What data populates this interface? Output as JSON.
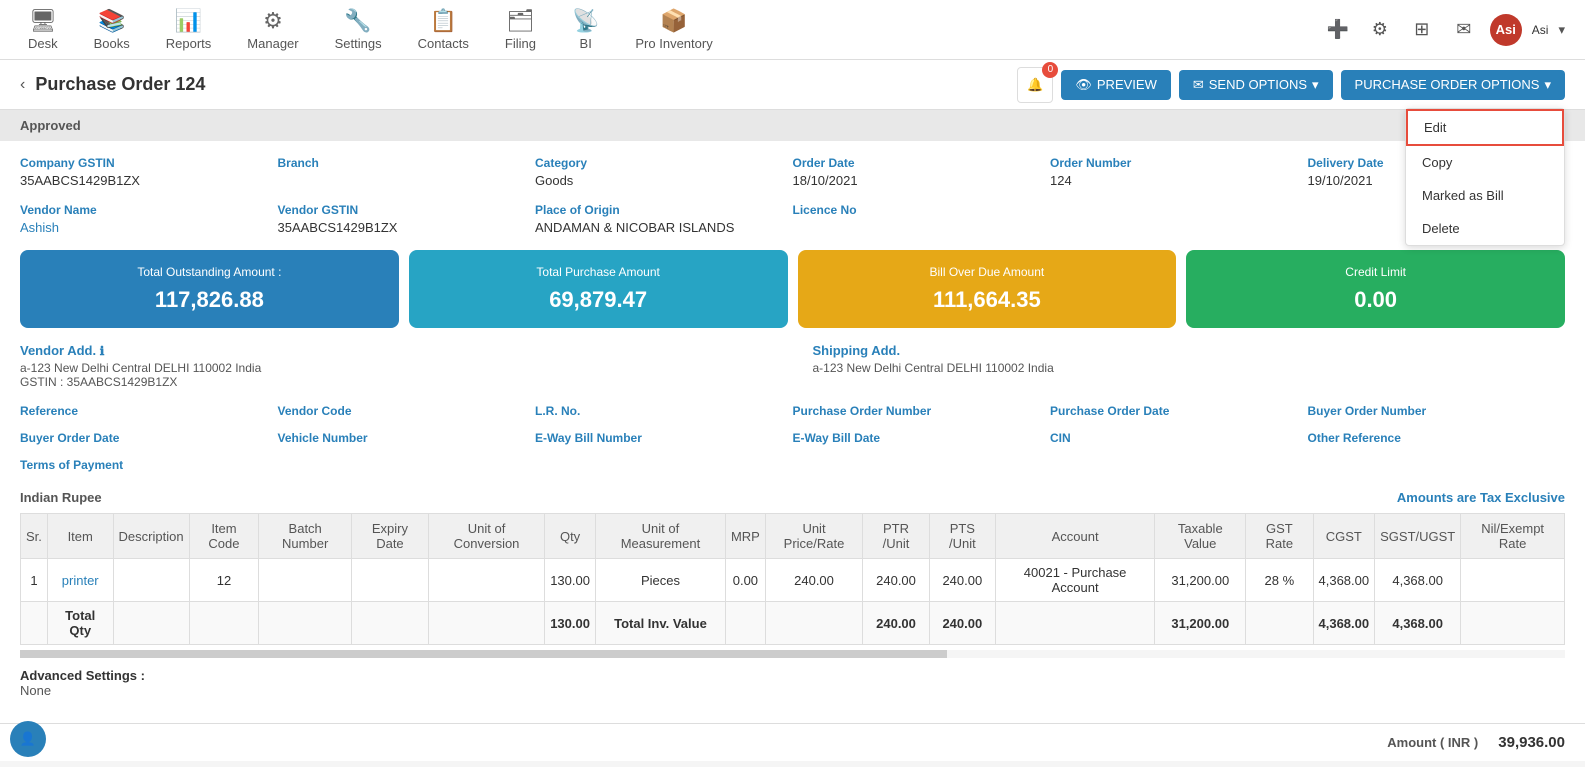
{
  "nav": {
    "items": [
      {
        "id": "desk",
        "label": "Desk",
        "icon": "🖥"
      },
      {
        "id": "books",
        "label": "Books",
        "icon": "📚"
      },
      {
        "id": "reports",
        "label": "Reports",
        "icon": "📊"
      },
      {
        "id": "manager",
        "label": "Manager",
        "icon": "⚙"
      },
      {
        "id": "settings",
        "label": "Settings",
        "icon": "🔧"
      },
      {
        "id": "contacts",
        "label": "Contacts",
        "icon": "📋"
      },
      {
        "id": "filing",
        "label": "Filing",
        "icon": "🗂"
      },
      {
        "id": "bi",
        "label": "BI",
        "icon": "📡"
      },
      {
        "id": "pro_inventory",
        "label": "Pro Inventory",
        "icon": "📦"
      }
    ],
    "user_initials": "Asi",
    "badge_count": "0"
  },
  "page": {
    "title": "Purchase Order 124",
    "back_label": "‹",
    "status": "Approved",
    "bell_count": "0"
  },
  "buttons": {
    "preview": "PREVIEW",
    "send_options": "SEND OPTIONS",
    "po_options": "PURCHASE ORDER OPTIONS",
    "dropdown": {
      "edit": "Edit",
      "copy": "Copy",
      "marked_as_bill": "Marked as Bill",
      "delete": "Delete"
    }
  },
  "fields": {
    "company_gstin_label": "Company GSTIN",
    "company_gstin_value": "35AABCS1429B1ZX",
    "branch_label": "Branch",
    "branch_value": "",
    "category_label": "Category",
    "category_value": "Goods",
    "order_date_label": "Order Date",
    "order_date_value": "18/10/2021",
    "order_number_label": "Order Number",
    "order_number_value": "124",
    "delivery_date_label": "Delivery Date",
    "delivery_date_value": "19/10/2021",
    "vendor_name_label": "Vendor Name",
    "vendor_name_value": "Ashish",
    "vendor_gstin_label": "Vendor GSTIN",
    "vendor_gstin_value": "35AABCS1429B1ZX",
    "place_of_origin_label": "Place of Origin",
    "place_of_origin_value": "ANDAMAN & NICOBAR ISLANDS",
    "licence_no_label": "Licence No",
    "licence_no_value": ""
  },
  "cards": {
    "total_outstanding_label": "Total Outstanding Amount :",
    "total_outstanding_value": "117,826.88",
    "total_purchase_label": "Total Purchase Amount",
    "total_purchase_value": "69,879.47",
    "bill_overdue_label": "Bill Over Due Amount",
    "bill_overdue_value": "111,664.35",
    "credit_limit_label": "Credit Limit",
    "credit_limit_value": "0.00"
  },
  "addresses": {
    "vendor_add_label": "Vendor Add.",
    "vendor_add_line1": "a-123 New Delhi Central DELHI 110002 India",
    "vendor_add_gstin": "GSTIN : 35AABCS1429B1ZX",
    "shipping_add_label": "Shipping Add.",
    "shipping_add_line1": "a-123 New Delhi Central DELHI 110002 India"
  },
  "ref_fields": {
    "reference_label": "Reference",
    "vendor_code_label": "Vendor Code",
    "lr_no_label": "L.R. No.",
    "po_number_label": "Purchase Order Number",
    "po_date_label": "Purchase Order Date",
    "buyer_order_number_label": "Buyer Order Number",
    "buyer_order_date_label": "Buyer Order Date",
    "vehicle_number_label": "Vehicle Number",
    "eway_bill_number_label": "E-Way Bill Number",
    "eway_bill_date_label": "E-Way Bill Date",
    "cin_label": "CIN",
    "other_reference_label": "Other Reference",
    "terms_of_payment_label": "Terms of Payment"
  },
  "table": {
    "currency": "Indian Rupee",
    "tax_exclusive": "Amounts are Tax Exclusive",
    "columns": [
      "Sr.",
      "Item",
      "Description",
      "Item Code",
      "Batch Number",
      "Expiry Date",
      "Unit of Conversion",
      "Qty",
      "Unit of Measurement",
      "MRP",
      "Unit Price/Rate",
      "PTR /Unit",
      "PTS /Unit",
      "Account",
      "Taxable Value",
      "GST Rate",
      "CGST",
      "SGST/UGST",
      "Nil/Exempt Rate"
    ],
    "rows": [
      {
        "sr": "1",
        "item": "printer",
        "description": "",
        "item_code": "12",
        "batch_number": "",
        "expiry_date": "",
        "unit_conversion": "",
        "qty": "130.00",
        "uom": "Pieces",
        "mrp": "0.00",
        "unit_price": "240.00",
        "ptr": "240.00",
        "pts": "240.00",
        "account": "40021 - Purchase Account",
        "taxable_value": "31,200.00",
        "gst_rate": "28 %",
        "cgst": "4,368.00",
        "sgst": "4,368.00",
        "nil_exempt": ""
      }
    ],
    "total_row": {
      "qty": "130.00",
      "total_inv_value_label": "Total Inv. Value",
      "ptr": "240.00",
      "pts": "240.00",
      "taxable_value": "31,200.00",
      "cgst": "4,368.00",
      "sgst": "4,368.00"
    }
  },
  "advanced": {
    "label": "Advanced Settings :",
    "value": "None"
  },
  "footer": {
    "amount_label": "Amount ( INR )",
    "amount_value": "39,936.00"
  }
}
